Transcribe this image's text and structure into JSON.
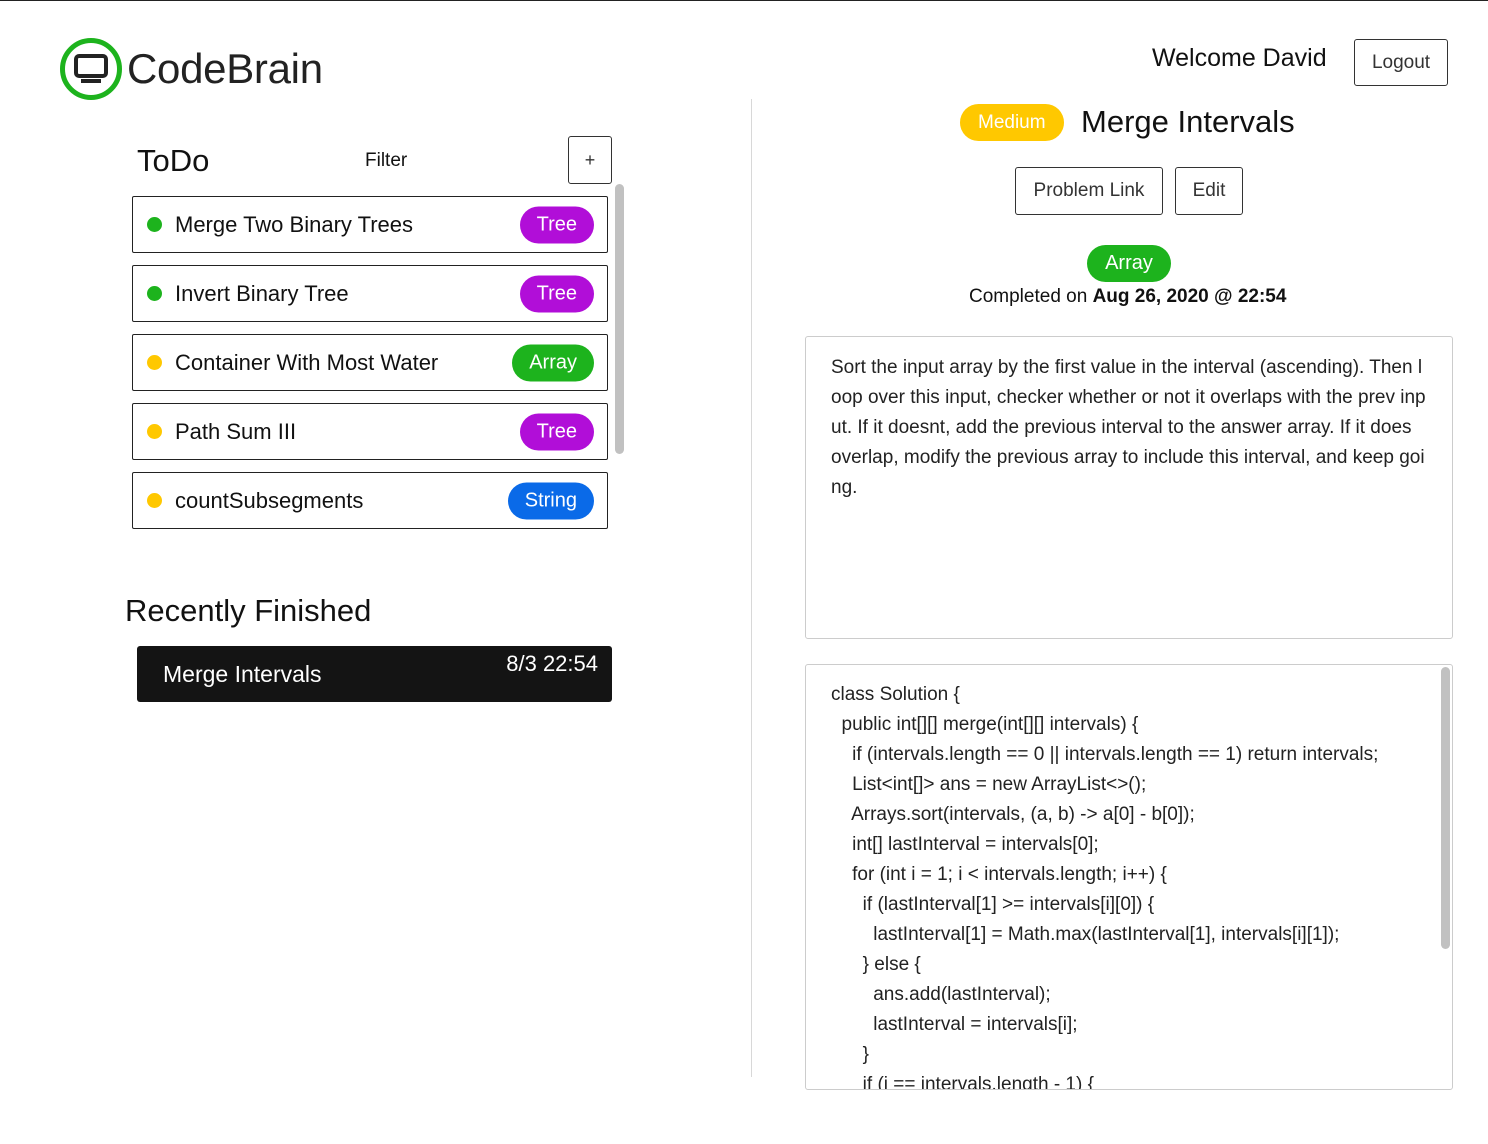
{
  "header": {
    "app_name": "CodeBrain",
    "welcome_text": "Welcome David",
    "logout_label": "Logout"
  },
  "todo": {
    "title": "ToDo",
    "filter_label": "Filter",
    "add_label": "+",
    "items": [
      {
        "name": "Merge Two Binary Trees",
        "tag": "Tree",
        "status_color": "#1db31d",
        "tag_color": "#b10ed8"
      },
      {
        "name": "Invert Binary Tree",
        "tag": "Tree",
        "status_color": "#1db31d",
        "tag_color": "#b10ed8"
      },
      {
        "name": "Container With Most Water",
        "tag": "Array",
        "status_color": "#ffc800",
        "tag_color": "#1db31d"
      },
      {
        "name": "Path Sum III",
        "tag": "Tree",
        "status_color": "#ffc800",
        "tag_color": "#b10ed8"
      },
      {
        "name": "countSubsegments",
        "tag": "String",
        "status_color": "#ffc800",
        "tag_color": "#0a6ae8"
      }
    ]
  },
  "recent": {
    "title": "Recently Finished",
    "items": [
      {
        "name": "Merge Intervals",
        "time": "8/3 22:54"
      }
    ]
  },
  "problem": {
    "difficulty": "Medium",
    "difficulty_color": "#ffc800",
    "title": "Merge Intervals",
    "problem_link_label": "Problem Link",
    "edit_label": "Edit",
    "topic": "Array",
    "topic_color": "#1db31d",
    "completed_prefix": "Completed on ",
    "completed_date": "Aug 26, 2020 @ 22:54",
    "notes": "Sort the input array by the first value in the interval (ascending). Then loop over this input, checker whether or not it overlaps with the prev input. If it doesnt, add the previous interval to the answer array. If it does overlap, modify the previous array to include this interval, and keep going.",
    "code_lines": [
      "class Solution {",
      "  public int[][] merge(int[][] intervals) {",
      "    if (intervals.length == 0 || intervals.length == 1) return intervals;",
      "    List<int[]> ans = new ArrayList<>();",
      "    Arrays.sort(intervals, (a, b) -> a[0] - b[0]);",
      "    int[] lastInterval = intervals[0];",
      "    for (int i = 1; i < intervals.length; i++) {",
      "      if (lastInterval[1] >= intervals[i][0]) {",
      "        lastInterval[1] = Math.max(lastInterval[1], intervals[i][1]);",
      "      } else {",
      "        ans.add(lastInterval);",
      "        lastInterval = intervals[i];",
      "      }",
      "      if (i == intervals.length - 1) {"
    ]
  }
}
